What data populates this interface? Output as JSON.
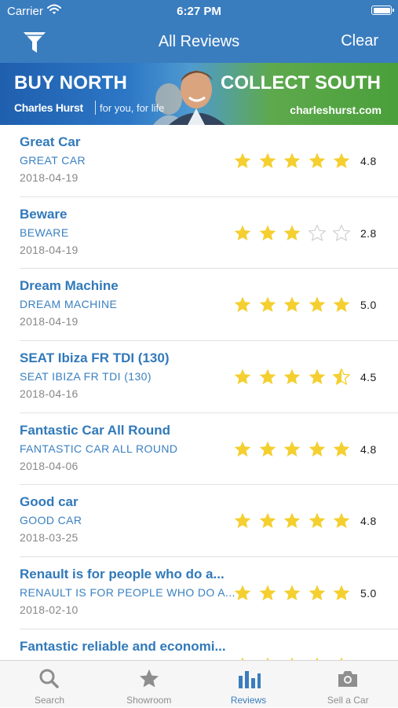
{
  "status_bar": {
    "carrier": "Carrier",
    "time": "6:27 PM"
  },
  "nav": {
    "title": "All Reviews",
    "clear_label": "Clear",
    "filter_icon": "filter-icon"
  },
  "banner": {
    "left_title": "BUY NORTH",
    "right_title": "COLLECT SOUTH",
    "brand": "Charles Hurst",
    "tagline": "for you, for life",
    "url": "charleshurst.com"
  },
  "reviews": [
    {
      "title": "Great Car",
      "subtitle": "GREAT CAR",
      "date": "2018-04-19",
      "rating": 4.8,
      "rating_label": "4.8"
    },
    {
      "title": "Beware",
      "subtitle": "BEWARE",
      "date": "2018-04-19",
      "rating": 2.8,
      "rating_label": "2.8"
    },
    {
      "title": "Dream Machine",
      "subtitle": "DREAM MACHINE",
      "date": "2018-04-19",
      "rating": 5.0,
      "rating_label": "5.0"
    },
    {
      "title": "SEAT Ibiza FR TDI (130)",
      "subtitle": "SEAT IBIZA FR TDI (130)",
      "date": "2018-04-16",
      "rating": 4.5,
      "rating_label": "4.5"
    },
    {
      "title": "Fantastic Car All Round",
      "subtitle": "FANTASTIC CAR ALL ROUND",
      "date": "2018-04-06",
      "rating": 4.8,
      "rating_label": "4.8"
    },
    {
      "title": "Good car",
      "subtitle": "GOOD CAR",
      "date": "2018-03-25",
      "rating": 4.8,
      "rating_label": "4.8"
    },
    {
      "title": "Renault is for people who do a...",
      "subtitle": "RENAULT IS FOR PEOPLE WHO DO A...",
      "date": "2018-02-10",
      "rating": 5.0,
      "rating_label": "5.0"
    },
    {
      "title": "Fantastic reliable and economi...",
      "subtitle": "",
      "date": "",
      "rating": 5.0,
      "rating_label": ""
    }
  ],
  "tabs": [
    {
      "label": "Search",
      "icon": "search-icon"
    },
    {
      "label": "Showroom",
      "icon": "star-icon"
    },
    {
      "label": "Reviews",
      "icon": "bar-chart-icon",
      "active": true
    },
    {
      "label": "Sell a Car",
      "icon": "camera-icon"
    }
  ],
  "colors": {
    "nav_background": "#3a7dbf",
    "star_filled": "#f4cf2f",
    "title_blue": "#3179ba",
    "tab_active": "#3a7dbf",
    "tab_inactive": "#8e8e8e"
  }
}
